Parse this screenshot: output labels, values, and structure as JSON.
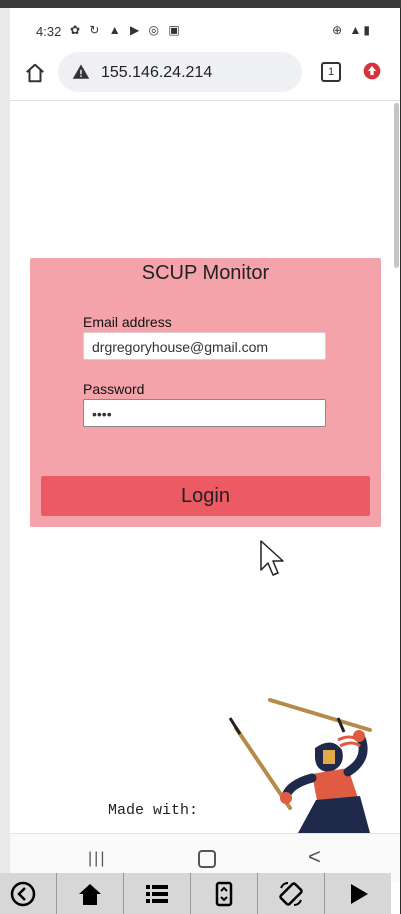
{
  "status_bar": {
    "time": "4:32",
    "left_icons": "✿ ↻ ▲ ▶ ◎ ▣",
    "right_icons": "⊕ ▲▮"
  },
  "browser": {
    "url": "155.146.24.214",
    "tab_count": "1"
  },
  "login": {
    "title": "SCUP Monitor",
    "email_label": "Email address",
    "email_value": "drgregoryhouse@gmail.com",
    "password_label": "Password",
    "password_value": "••••",
    "button_label": "Login"
  },
  "footer": {
    "made_with": "Made with:"
  },
  "android_nav": {
    "recent": "|||",
    "back": "<"
  },
  "colors": {
    "card": "#f5a3aa",
    "button": "#ec5a63",
    "browser_red": "#d8323c"
  }
}
